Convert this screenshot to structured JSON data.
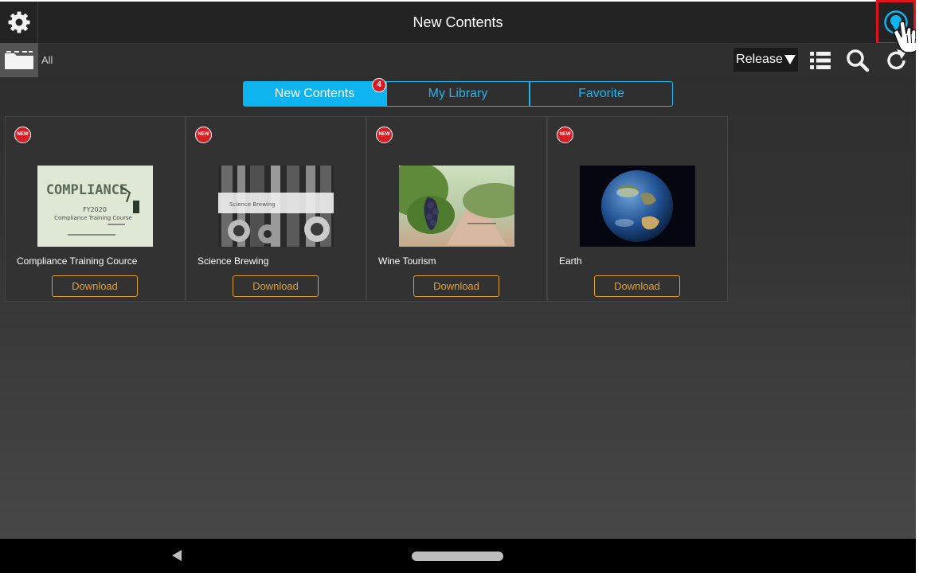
{
  "header": {
    "title": "New Contents",
    "settings_icon": "gear-icon",
    "user_icon": "user-pin-icon"
  },
  "toolbar": {
    "folder_label": "All",
    "sort_label": "Release",
    "sort_icon": "caret-down-icon",
    "icons": [
      "list-icon",
      "search-icon",
      "refresh-icon"
    ]
  },
  "tabs": [
    {
      "label": "New Contents",
      "badge": "4",
      "active": true
    },
    {
      "label": "My Library",
      "active": false
    },
    {
      "label": "Favorite",
      "active": false
    }
  ],
  "items": [
    {
      "badge": "NEW",
      "title": "Compliance Training Cource",
      "action": "Download",
      "thumb": {
        "heading": "COMPLIANCE",
        "line1": "FY2020",
        "line2": "Compliance Training Course"
      }
    },
    {
      "badge": "NEW",
      "title": "Science Brewing",
      "action": "Download",
      "thumb": {
        "caption": "Science Brewing"
      }
    },
    {
      "badge": "NEW",
      "title": "Wine Tourism",
      "action": "Download",
      "thumb": {}
    },
    {
      "badge": "NEW",
      "title": "Earth",
      "action": "Download",
      "thumb": {}
    }
  ],
  "colors": {
    "accent": "#0eb4ef",
    "download": "#e0a030",
    "badge": "#d81b25",
    "highlight": "#e0141c"
  }
}
